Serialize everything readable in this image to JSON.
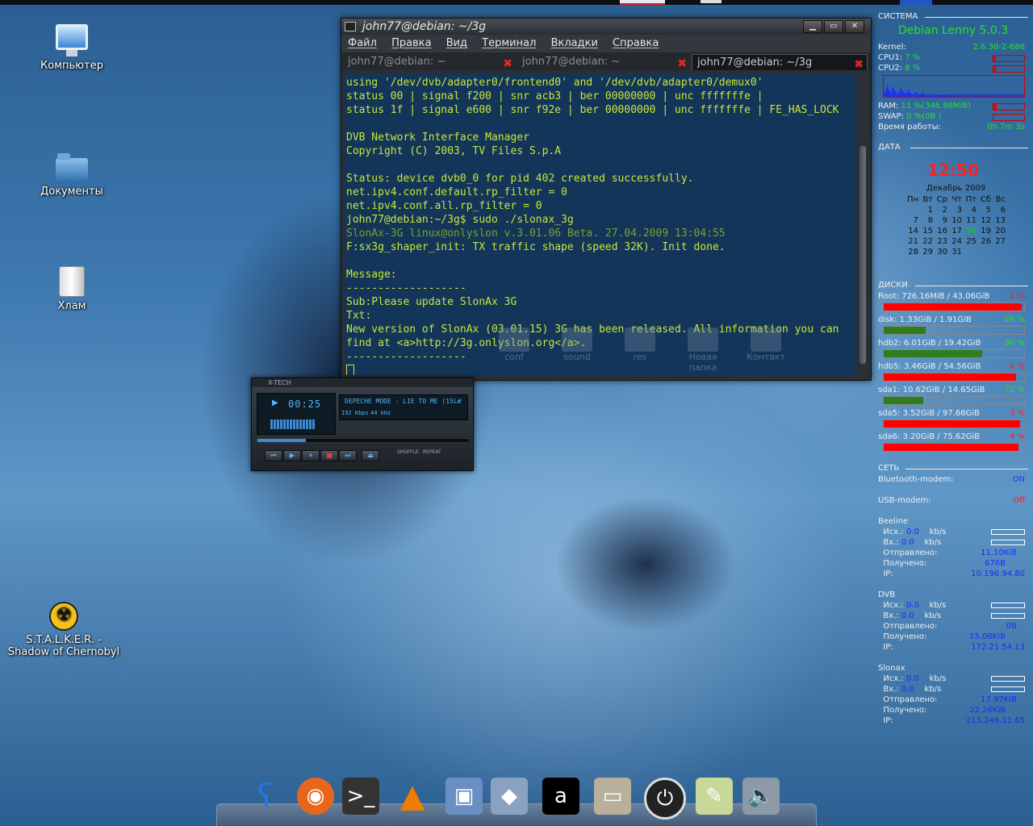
{
  "desktop": {
    "icons": [
      {
        "label": "Компьютер",
        "icon": "computer-icon"
      },
      {
        "label": "Документы",
        "icon": "home-folder-icon"
      },
      {
        "label": "Хлам",
        "icon": "trash-icon"
      },
      {
        "label": "S.T.A.L.K.E.R. -",
        "label2": "Shadow of Chernobyl",
        "icon": "radiation-icon"
      }
    ]
  },
  "terminal": {
    "title": "john77@debian: ~/3g",
    "buttons": {
      "minimize": "▁",
      "maximize": "▭",
      "close": "✕"
    },
    "menu": [
      "Файл",
      "Правка",
      "Вид",
      "Терминал",
      "Вкладки",
      "Справка"
    ],
    "tabs": [
      {
        "label": "john77@debian: ~"
      },
      {
        "label": "john77@debian: ~"
      },
      {
        "label": "john77@debian: ~/3g"
      }
    ],
    "lines": [
      "using '/dev/dvb/adapter0/frontend0' and '/dev/dvb/adapter0/demux0'",
      "status 00 | signal f200 | snr acb3 | ber 00000000 | unc fffffffe |",
      "status 1f | signal e600 | snr f92e | ber 00000000 | unc fffffffe | FE_HAS_LOCK",
      "",
      "DVB Network Interface Manager",
      "Copyright (C) 2003, TV Files S.p.A",
      "",
      "Status: device dvb0_0 for pid 402 created successfully.",
      "net.ipv4.conf.default.rp_filter = 0",
      "net.ipv4.conf.all.rp_filter = 0",
      "john77@debian:~/3g$ sudo ./slonax_3g",
      "SlonAx-3G linux@onlyslon v.3.01.06 Beta. 27.04.2009 13:04:55",
      "F:sx3g_shaper_init: TX traffic shape (speed 32K). Init done.",
      "",
      "Message:",
      "-------------------",
      "Sub:Please update SlonAx 3G",
      "Txt:",
      "New version of SlonAx (03.01.15) 3G has been released. All information you can",
      "find at <a>http://3g.onlyslon.org</a>.",
      "-------------------"
    ],
    "ghost_folders": [
      "conf",
      "sound",
      "res",
      "Новая папка",
      "Контакт"
    ]
  },
  "player": {
    "title": "X-TECH",
    "time": "00:25",
    "song": "DEPECHE MODE - LIE TO ME (15L#",
    "kbps": "192 Kbps",
    "khz": "44 kHz",
    "shuffle": "SHUFFLE",
    "repeat": "REPEAT"
  },
  "conky": {
    "system_header": "СИСТЕМА",
    "distro": "Debian Lenny 5.0.3",
    "kernel_label": "Kernel:",
    "kernel": "2.6.30-2-686",
    "cpu1_label": "CPU1:",
    "cpu1": "7 %",
    "cpu1_pct": 7,
    "cpu2_label": "CPU2:",
    "cpu2": "8 %",
    "cpu2_pct": 8,
    "ram_label": "RAM:",
    "ram": "11 %(346.98MiB)",
    "ram_pct": 11,
    "swap_label": "SWAP:",
    "swap": "0 %(0B )",
    "swap_pct": 0,
    "uptime_label": "Время работы:",
    "uptime": "0h 7m 3s",
    "date_header": "ДАТА",
    "clock": "12:50",
    "calendar": {
      "month": "Декабрь 2009",
      "weekdays": [
        "Пн",
        "Вт",
        "Ср",
        "Чт",
        "Пт",
        "Сб",
        "Вс"
      ],
      "weeks": [
        [
          "",
          "1",
          "2",
          "3",
          "4",
          "5",
          "6"
        ],
        [
          "7",
          "8",
          "9",
          "10",
          "11",
          "12",
          "13"
        ],
        [
          "14",
          "15",
          "16",
          "17",
          "18",
          "19",
          "20"
        ],
        [
          "21",
          "22",
          "23",
          "24",
          "25",
          "26",
          "27"
        ],
        [
          "28",
          "29",
          "30",
          "31",
          "",
          "",
          ""
        ]
      ],
      "today": "18"
    },
    "disks_header": "ДИСКИ",
    "disks": [
      {
        "label": "Root: 726.16MiB / 43.06GiB",
        "pct": "1 %",
        "fill": 0.98,
        "color": "#ff0000"
      },
      {
        "label": "disk: 1.33GiB  / 1.91GiB",
        "pct": "69 %",
        "fill": 0.3,
        "color": "#2f7d1f"
      },
      {
        "label": "hdb2: 6.01GiB  / 19.42GiB",
        "pct": "30 %",
        "fill": 0.7,
        "color": "#2f7d1f"
      },
      {
        "label": "hdb5: 3.46GiB  / 54.56GiB",
        "pct": "6 %",
        "fill": 0.94,
        "color": "#ff0000"
      },
      {
        "label": "sda1: 10.62GiB  / 14.65GiB",
        "pct": "72 %",
        "fill": 0.28,
        "color": "#2f7d1f"
      },
      {
        "label": "sda5: 3.52GiB  / 97.66GiB",
        "pct": "3 %",
        "fill": 0.97,
        "color": "#ff0000"
      },
      {
        "label": "sda6: 3.20GiB  / 75.62GiB",
        "pct": "4 %",
        "fill": 0.96,
        "color": "#ff0000"
      }
    ],
    "net_header": "СЕТЬ",
    "bluetooth_label": "Bluetooth-modem:",
    "bluetooth": "ON",
    "usb_label": "USB-modem:",
    "usb": "Off",
    "connections": [
      {
        "name": "Beeline",
        "up": "0.0",
        "down": "0.0",
        "sent": "11.10KiB",
        "recv": "676B",
        "ip": "10.196.94.80"
      },
      {
        "name": "DVB",
        "up": "0.0",
        "down": "0.0",
        "sent": "0B",
        "recv": "15.06KiB",
        "ip": "172.21.54.13"
      },
      {
        "name": "Slonax",
        "up": "0.0",
        "down": "0.0",
        "sent": "17.97KiB",
        "recv": "22.26KiB",
        "ip": "213.246.11.65"
      }
    ],
    "up_label": "Исх.:",
    "down_label": "Вх.:",
    "unit": "kb/s",
    "sent_label": "Отправлено:",
    "recv_label": "Получено:",
    "ip_label": "IP:"
  },
  "dock": {
    "items": [
      {
        "name": "gnome-foot-icon",
        "glyph": "ʕ",
        "color": "#1e78e0"
      },
      {
        "name": "firefox-icon",
        "glyph": "◉",
        "color": "#e8661c"
      },
      {
        "name": "terminal-icon",
        "glyph": ">_",
        "color": "#333333"
      },
      {
        "name": "vlc-icon",
        "glyph": "▲",
        "color": "#ef7d00"
      },
      {
        "name": "network-manager-icon",
        "glyph": "▣",
        "color": "#6b8fc4"
      },
      {
        "name": "pencil-ruler-icon",
        "glyph": "◆",
        "color": "#8aa2c2"
      },
      {
        "name": "amarok-icon",
        "glyph": "a",
        "color": "#000000"
      },
      {
        "name": "folder-icon",
        "glyph": "▭",
        "color": "#b8b09a"
      },
      {
        "name": "power-icon",
        "glyph": "⏻",
        "color": "#222222"
      },
      {
        "name": "text-editor-icon",
        "glyph": "✎",
        "color": "#c8d898"
      },
      {
        "name": "speaker-icon",
        "glyph": "🔈",
        "color": "#8c9aa8"
      }
    ]
  }
}
